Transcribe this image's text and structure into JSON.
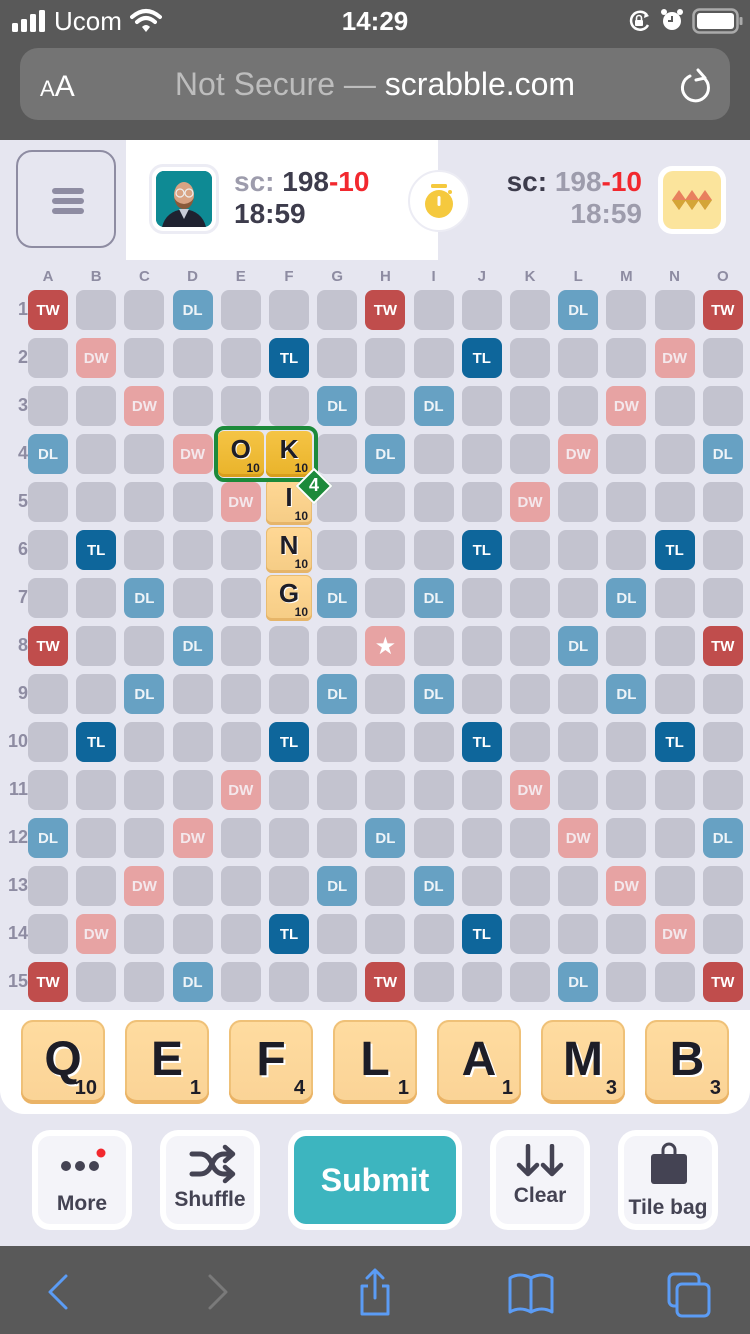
{
  "status_bar": {
    "carrier": "Ucom",
    "time": "14:29",
    "icons": [
      "signal-icon",
      "wifi-icon",
      "orientation-lock-icon",
      "alarm-icon",
      "battery-icon"
    ]
  },
  "browser": {
    "text_size_label_small": "A",
    "text_size_label_large": "A",
    "security_text": "Not Secure —",
    "host": "scrabble.com",
    "reload_icon": "reload-icon"
  },
  "header": {
    "menu_icon": "hamburger-icon",
    "player1": {
      "score_label": "sc:",
      "score": "198",
      "penalty": "-10",
      "time": "18:59"
    },
    "timer_icon": "stopwatch-icon",
    "player2": {
      "score_label": "sc:",
      "score": "198",
      "penalty": "-10",
      "time": "18:59"
    }
  },
  "board": {
    "columns": [
      "A",
      "B",
      "C",
      "D",
      "E",
      "F",
      "G",
      "H",
      "I",
      "J",
      "K",
      "L",
      "M",
      "N",
      "O"
    ],
    "rows": [
      "1",
      "2",
      "3",
      "4",
      "5",
      "6",
      "7",
      "8",
      "9",
      "10",
      "11",
      "12",
      "13",
      "14",
      "15"
    ],
    "premium_rows": [
      "T..d...T...d..T",
      ".D...t...t...D.",
      "..D...d.d...D..",
      "d..D...d...D..d",
      "....D.....D....",
      ".t...t...t...t.",
      "..d...d.d...d..",
      "T..d...S...d..T",
      "..d...d.d...d..",
      ".t...t...t...t.",
      "....D.....D....",
      "d..D...d...D..d",
      "..D...d.d...D..",
      ".D...t...t...D.",
      "T..d...T...d..T"
    ],
    "premium_labels": {
      "T": "TW",
      "D": "DW",
      "d": "DL",
      "t": "TL",
      "S": "★"
    },
    "placed_tiles": [
      {
        "letter": "O",
        "value": "10",
        "col": 4,
        "row": 3,
        "selected": true
      },
      {
        "letter": "K",
        "value": "10",
        "col": 5,
        "row": 3,
        "selected": true
      },
      {
        "letter": "I",
        "value": "10",
        "col": 5,
        "row": 4,
        "selected": false
      },
      {
        "letter": "N",
        "value": "10",
        "col": 5,
        "row": 5,
        "selected": false
      },
      {
        "letter": "G",
        "value": "10",
        "col": 5,
        "row": 6,
        "selected": false
      }
    ],
    "word_score_badge": "4"
  },
  "rack": [
    {
      "letter": "Q",
      "value": "10"
    },
    {
      "letter": "E",
      "value": "1"
    },
    {
      "letter": "F",
      "value": "4"
    },
    {
      "letter": "L",
      "value": "1"
    },
    {
      "letter": "A",
      "value": "1"
    },
    {
      "letter": "M",
      "value": "3"
    },
    {
      "letter": "B",
      "value": "3"
    }
  ],
  "actions": {
    "more_label": "More",
    "shuffle_label": "Shuffle",
    "submit_label": "Submit",
    "clear_label": "Clear",
    "tilebag_label": "Tile bag"
  },
  "colors": {
    "accent_submit": "#3db5bf",
    "tw": "#c04d4c",
    "dw": "#e7a3a3",
    "dl": "#67a1c3",
    "tl": "#0e669b",
    "penalty": "#f2282e",
    "word_frame": "#1c8a3a",
    "notification_dot": "#f2282e"
  },
  "toolbar": {
    "icons": [
      "back-icon",
      "forward-icon",
      "share-icon",
      "bookmarks-icon",
      "tabs-icon"
    ]
  }
}
